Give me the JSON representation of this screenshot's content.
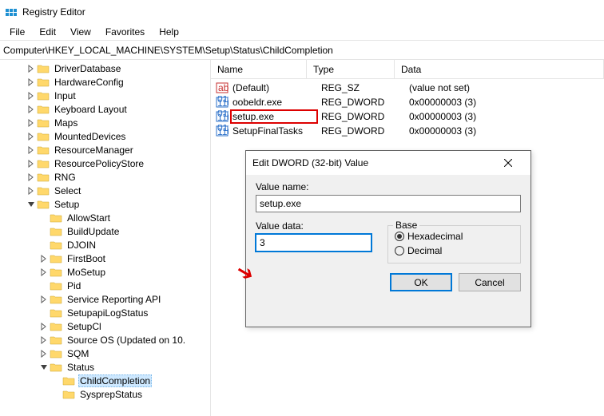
{
  "window": {
    "title": "Registry Editor"
  },
  "menu": [
    "File",
    "Edit",
    "View",
    "Favorites",
    "Help"
  ],
  "address": "Computer\\HKEY_LOCAL_MACHINE\\SYSTEM\\Setup\\Status\\ChildCompletion",
  "tree": [
    {
      "indent": 2,
      "tw": ">",
      "label": "DriverDatabase"
    },
    {
      "indent": 2,
      "tw": ">",
      "label": "HardwareConfig"
    },
    {
      "indent": 2,
      "tw": ">",
      "label": "Input"
    },
    {
      "indent": 2,
      "tw": ">",
      "label": "Keyboard Layout"
    },
    {
      "indent": 2,
      "tw": ">",
      "label": "Maps"
    },
    {
      "indent": 2,
      "tw": ">",
      "label": "MountedDevices"
    },
    {
      "indent": 2,
      "tw": ">",
      "label": "ResourceManager"
    },
    {
      "indent": 2,
      "tw": ">",
      "label": "ResourcePolicyStore"
    },
    {
      "indent": 2,
      "tw": ">",
      "label": "RNG"
    },
    {
      "indent": 2,
      "tw": ">",
      "label": "Select"
    },
    {
      "indent": 2,
      "tw": "v",
      "label": "Setup"
    },
    {
      "indent": 3,
      "tw": "",
      "label": "AllowStart"
    },
    {
      "indent": 3,
      "tw": "",
      "label": "BuildUpdate"
    },
    {
      "indent": 3,
      "tw": "",
      "label": "DJOIN"
    },
    {
      "indent": 3,
      "tw": ">",
      "label": "FirstBoot"
    },
    {
      "indent": 3,
      "tw": ">",
      "label": "MoSetup"
    },
    {
      "indent": 3,
      "tw": "",
      "label": "Pid"
    },
    {
      "indent": 3,
      "tw": ">",
      "label": "Service Reporting API"
    },
    {
      "indent": 3,
      "tw": "",
      "label": "SetupapiLogStatus"
    },
    {
      "indent": 3,
      "tw": ">",
      "label": "SetupCl"
    },
    {
      "indent": 3,
      "tw": ">",
      "label": "Source OS (Updated on 10."
    },
    {
      "indent": 3,
      "tw": ">",
      "label": "SQM"
    },
    {
      "indent": 3,
      "tw": "v",
      "label": "Status"
    },
    {
      "indent": 4,
      "tw": "",
      "label": "ChildCompletion",
      "selected": true
    },
    {
      "indent": 4,
      "tw": "",
      "label": "SysprepStatus"
    }
  ],
  "list": {
    "headers": {
      "name": "Name",
      "type": "Type",
      "data": "Data"
    },
    "rows": [
      {
        "icon": "string",
        "name": "(Default)",
        "type": "REG_SZ",
        "data": "(value not set)"
      },
      {
        "icon": "dword",
        "name": "oobeldr.exe",
        "type": "REG_DWORD",
        "data": "0x00000003 (3)"
      },
      {
        "icon": "dword",
        "name": "setup.exe",
        "type": "REG_DWORD",
        "data": "0x00000003 (3)",
        "highlight": true
      },
      {
        "icon": "dword",
        "name": "SetupFinalTasks",
        "type": "REG_DWORD",
        "data": "0x00000003 (3)"
      }
    ]
  },
  "dialog": {
    "title": "Edit DWORD (32-bit) Value",
    "value_name_label": "Value name:",
    "value_name": "setup.exe",
    "value_data_label": "Value data:",
    "value_data": "3",
    "base_label": "Base",
    "radio_hex": "Hexadecimal",
    "radio_dec": "Decimal",
    "ok": "OK",
    "cancel": "Cancel"
  }
}
